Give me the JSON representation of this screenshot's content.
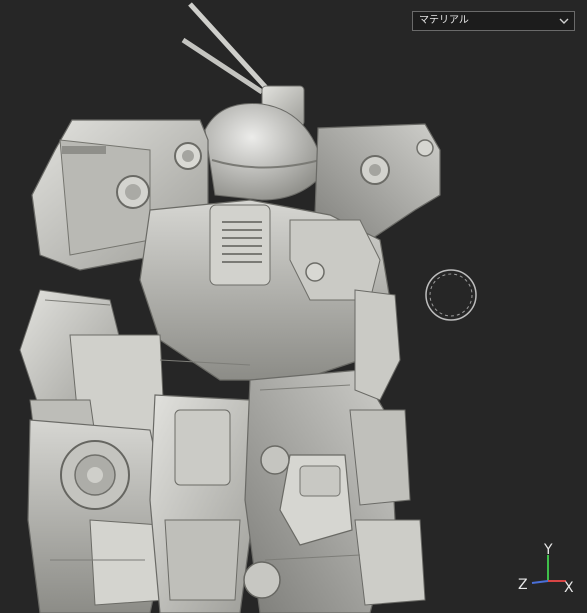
{
  "material_selector": {
    "label": "マテリアル",
    "icon": "chevron-down-icon"
  },
  "axis_gizmo": {
    "y_label": "Y",
    "x_label": "X",
    "z_label": "Z",
    "colors": {
      "y": "#3fbf4a",
      "x": "#d84545",
      "z": "#4a6fd8"
    }
  },
  "brush_cursor": {
    "icon": "brush-circle-icon"
  },
  "viewport": {
    "background": "#262626",
    "model_color": "#c9c9c4"
  }
}
